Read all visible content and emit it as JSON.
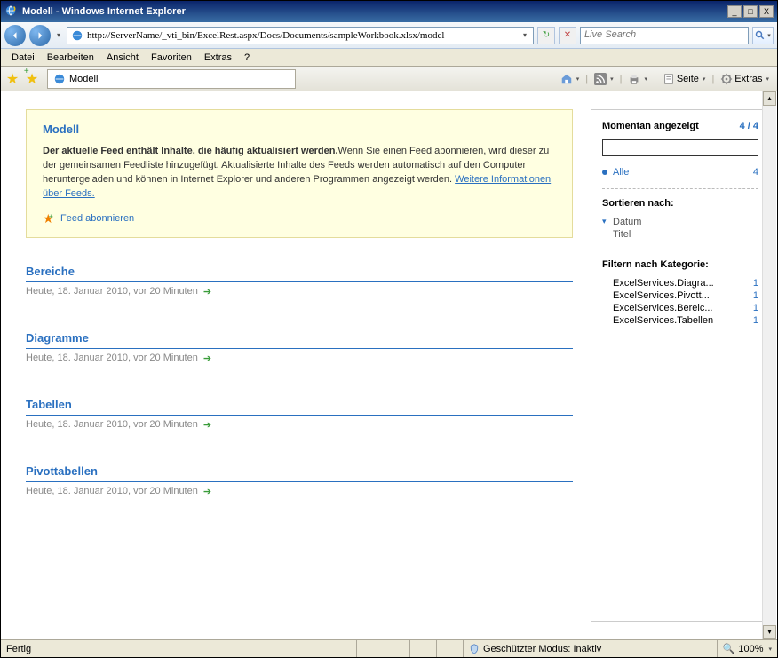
{
  "window": {
    "title": "Modell - Windows Internet Explorer"
  },
  "nav": {
    "url": "http://ServerName/_vti_bin/ExcelRest.aspx/Docs/Documents/sampleWorkbook.xlsx/model",
    "search_placeholder": "Live Search"
  },
  "menu": {
    "file": "Datei",
    "edit": "Bearbeiten",
    "view": "Ansicht",
    "favorites": "Favoriten",
    "extras": "Extras",
    "help": "?"
  },
  "tab": {
    "label": "Modell"
  },
  "toolbar_right": {
    "page": "Seite",
    "extras": "Extras"
  },
  "feed": {
    "title": "Modell",
    "desc_bold": "Der aktuelle Feed enthält Inhalte, die häufig aktualisiert werden.",
    "desc_rest": "Wenn Sie einen Feed abonnieren, wird dieser zu der gemeinsamen Feedliste hinzugefügt. Aktualisierte Inhalte des Feeds werden automatisch auf den Computer heruntergeladen und können in Internet Explorer und anderen Programmen angezeigt werden. ",
    "more_link": "Weitere Informationen über Feeds.",
    "subscribe": "Feed abonnieren"
  },
  "items": [
    {
      "title": "Bereiche",
      "date": "Heute, 18. Januar 2010, vor 20 Minuten"
    },
    {
      "title": "Diagramme",
      "date": "Heute, 18. Januar 2010, vor 20 Minuten"
    },
    {
      "title": "Tabellen",
      "date": "Heute, 18. Januar 2010, vor 20 Minuten"
    },
    {
      "title": "Pivottabellen",
      "date": "Heute, 18. Januar 2010, vor 20 Minuten"
    }
  ],
  "sidebar": {
    "displayed": "Momentan angezeigt",
    "count": "4 / 4",
    "all": "Alle",
    "all_count": "4",
    "sort_by": "Sortieren nach:",
    "sort_date": "Datum",
    "sort_title": "Titel",
    "filter_by": "Filtern nach Kategorie:",
    "cats": [
      {
        "name": "ExcelServices.Diagra...",
        "n": "1"
      },
      {
        "name": "ExcelServices.Pivott...",
        "n": "1"
      },
      {
        "name": "ExcelServices.Bereic...",
        "n": "1"
      },
      {
        "name": "ExcelServices.Tabellen",
        "n": "1"
      }
    ]
  },
  "status": {
    "ready": "Fertig",
    "protected": "Geschützter Modus: Inaktiv",
    "zoom": "100%"
  }
}
